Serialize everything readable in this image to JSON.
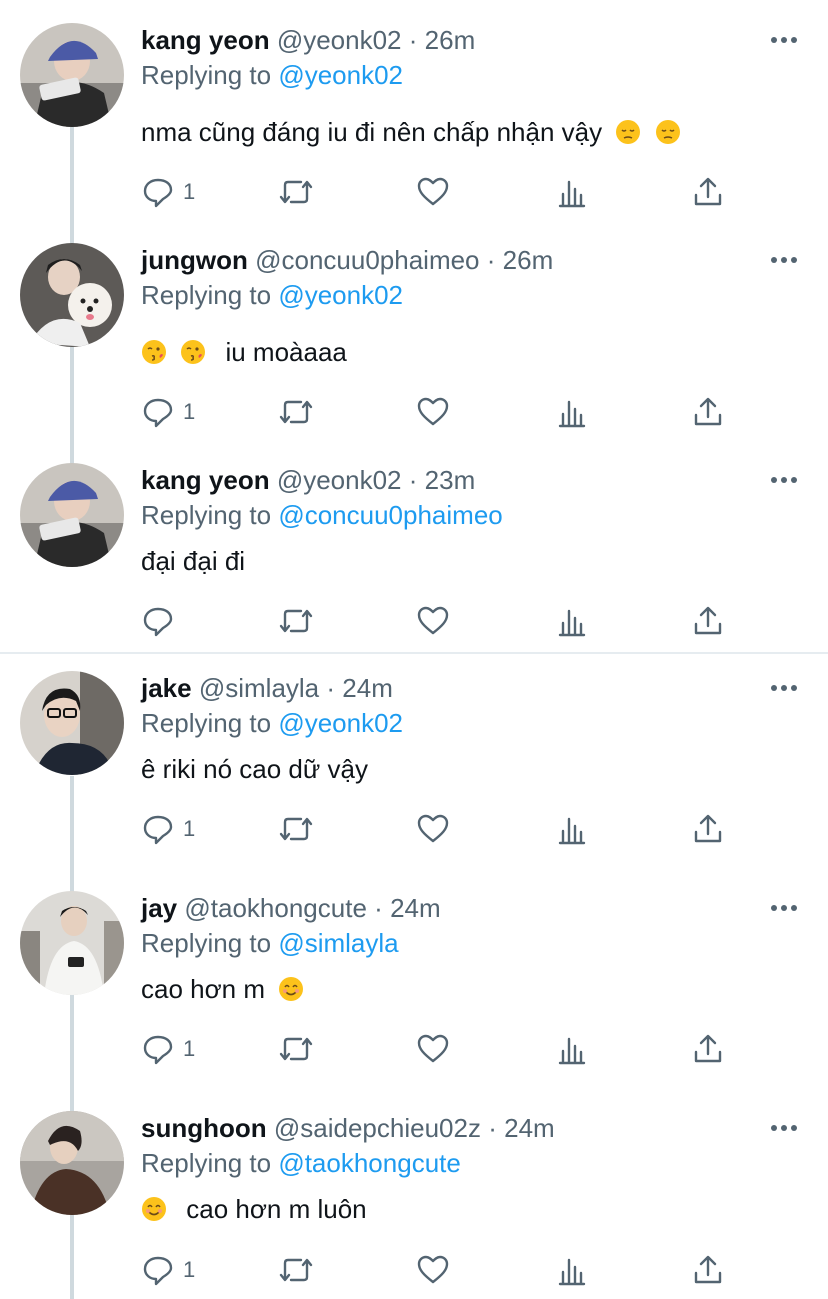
{
  "tweets": [
    {
      "name": "kang yeon",
      "handle": "@yeonk02",
      "time": "26m",
      "replying_label": "Replying to",
      "replying_to": "@yeonk02",
      "text": "nma cũng đáng iu đi nên chấp nhận vậy",
      "replies": "1"
    },
    {
      "name": "jungwon",
      "handle": "@concuu0phaimeo",
      "time": "26m",
      "replying_label": "Replying to",
      "replying_to": "@yeonk02",
      "text": "iu moàaaa",
      "replies": "1"
    },
    {
      "name": "kang yeon",
      "handle": "@yeonk02",
      "time": "23m",
      "replying_label": "Replying to",
      "replying_to": "@concuu0phaimeo",
      "text": "đại đại đi",
      "replies": ""
    },
    {
      "name": "jake",
      "handle": "@simlayla",
      "time": "24m",
      "replying_label": "Replying to",
      "replying_to": "@yeonk02",
      "text": "ê riki nó cao dữ vậy",
      "replies": "1"
    },
    {
      "name": "jay",
      "handle": "@taokhongcute",
      "time": "24m",
      "replying_label": "Replying to",
      "replying_to": "@simlayla",
      "text": "cao hơn m",
      "replies": "1"
    },
    {
      "name": "sunghoon",
      "handle": "@saidepchieu02z",
      "time": "24m",
      "replying_label": "Replying to",
      "replying_to": "@taokhongcute",
      "text": "cao hơn m luôn",
      "replies": "1"
    }
  ],
  "dot": "·",
  "colors": {
    "accent": "#1d9bf0",
    "secondary_text": "#536471",
    "thread_line": "#cfd9de"
  },
  "icons": [
    "reply-icon",
    "retweet-icon",
    "like-icon",
    "analytics-icon",
    "share-icon",
    "more-icon"
  ]
}
